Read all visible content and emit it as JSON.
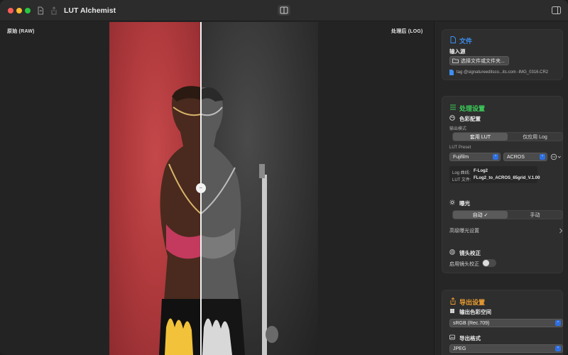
{
  "app": {
    "title": "LUT Alchemist"
  },
  "colors": {
    "file_accent": "#3d8ef0",
    "process_accent": "#3ccf5a",
    "export_accent": "#f0a030",
    "select_blue": "#2f6fe0"
  },
  "viewer": {
    "left_label": "原始 (RAW)",
    "right_label": "处理后 (LOG)",
    "split_handle_glyph": "⇔"
  },
  "file_section": {
    "title": "文件",
    "input_label": "输入源",
    "choose_button": "选择文件或文件夹...",
    "file_name": "tag @signatureeditsco...its.com -IMG_0316.CR2"
  },
  "process_section": {
    "title": "处理设置",
    "color_config_label": "色彩配置",
    "output_mode_label": "输出模式",
    "output_mode_options": [
      "套用 LUT",
      "仅应用 Log"
    ],
    "output_mode_selected": 0,
    "lut_preset_label": "LUT Preset",
    "brand_value": "Fujifilm",
    "style_value": "ACROS",
    "log_curve_label": "Log 曲线:",
    "log_curve_value": "F-Log2",
    "lut_file_label": "LUT 文件:",
    "lut_file_value": "FLog2_to_ACROS_65grid_V.1.00",
    "exposure_label": "曝光",
    "exposure_options": [
      "自动 ✓",
      "手动"
    ],
    "exposure_selected": 0,
    "advanced_exposure_label": "高级曝光设置",
    "lens_label": "镜头校正",
    "lens_toggle_label": "启用镜头校正"
  },
  "export_section": {
    "title": "导出设置",
    "color_space_label": "输出色彩空间",
    "color_space_value": "sRGB (Rec.709)",
    "format_label": "导出格式",
    "format_value": "JPEG"
  }
}
